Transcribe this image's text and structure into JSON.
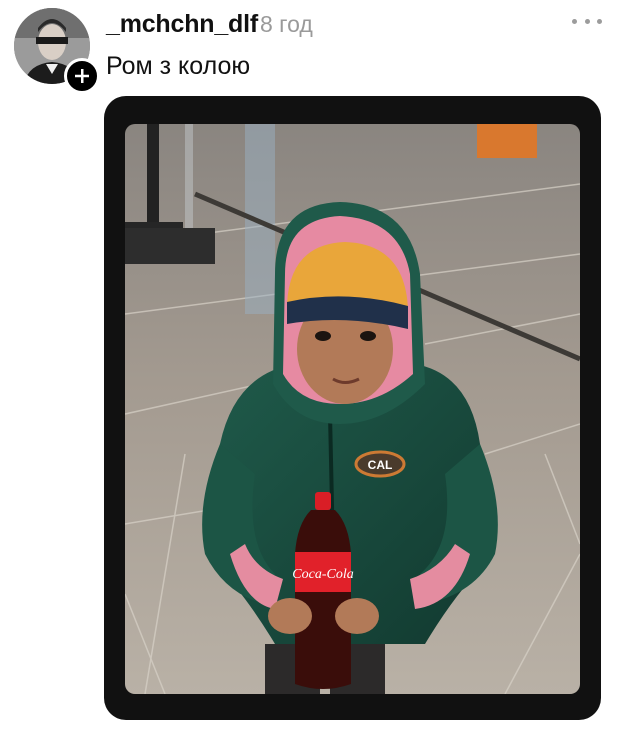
{
  "post": {
    "username": "_mchchn_dlf",
    "time": "8 год",
    "caption": "Ром з колою"
  },
  "icons": {
    "follow": "plus-icon",
    "more": "more-dots-icon"
  },
  "image": {
    "bottle_label": "Coca-Cola",
    "badge": "CAL"
  },
  "colors": {
    "username": "#111111",
    "time": "#9a9a9a",
    "frame": "#111111"
  }
}
